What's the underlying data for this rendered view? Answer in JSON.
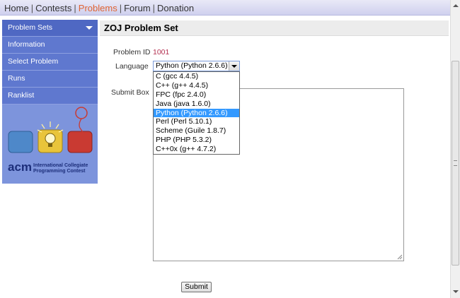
{
  "nav": {
    "items": [
      "Home",
      "Contests",
      "Problems",
      "Forum",
      "Donation"
    ],
    "active": "Problems"
  },
  "sidebar": {
    "header": "Problem Sets",
    "items": [
      "Information",
      "Select Problem",
      "Runs",
      "Ranklist"
    ],
    "logo": {
      "acm_text": "acm",
      "line1": "International Collegiate",
      "line2": "Programming Contest"
    }
  },
  "page": {
    "title": "ZOJ Problem Set"
  },
  "form": {
    "problem_id_label": "Problem ID",
    "problem_id_value": "1001",
    "language_label": "Language",
    "language_selected": "Python (Python 2.6.6)",
    "language_options": [
      "C (gcc 4.4.5)",
      "C++ (g++ 4.4.5)",
      "FPC (fpc 2.4.0)",
      "Java (java 1.6.0)",
      "Python (Python 2.6.6)",
      "Perl (Perl 5.10.1)",
      "Scheme (Guile 1.8.7)",
      "PHP (PHP 5.3.2)",
      "C++0x (g++ 4.7.2)"
    ],
    "submit_box_label": "Submit Box",
    "submit_box_value": "",
    "submit_button": "Submit"
  },
  "colors": {
    "nav_active": "#e06433",
    "sidebar_bg": "#5f78cf",
    "selected_option": "#3399ff",
    "problem_id": "#b33050"
  }
}
